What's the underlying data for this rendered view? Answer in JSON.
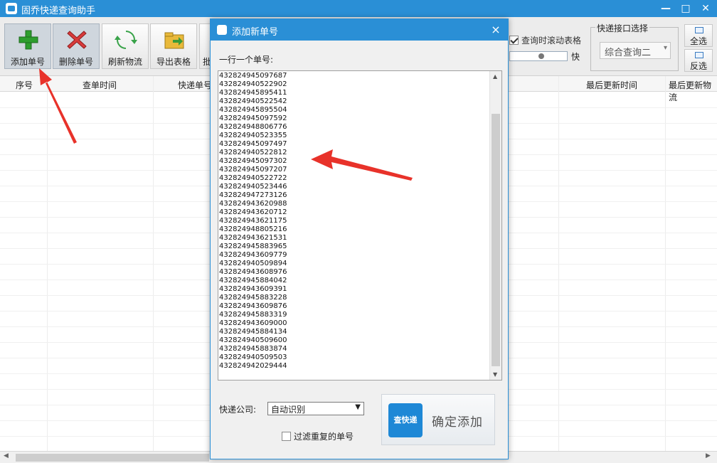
{
  "window": {
    "title": "固乔快递查询助手",
    "minimize": "—",
    "maximize": "□",
    "close": "✕"
  },
  "toolbar": {
    "add": "添加单号",
    "delete": "删除单号",
    "refresh": "刷新物流",
    "export": "导出表格",
    "partial_next": "批"
  },
  "options": {
    "scroll_checkbox": "查询时滚动表格",
    "scroll_checked": true,
    "speed_label": "快",
    "speed_level": 0.55,
    "api_group": "快递接口选择",
    "api_selected": "综合查询二",
    "select_all": "全选",
    "invert": "反选"
  },
  "grid": {
    "columns": [
      "序号",
      "查单时间",
      "快递单号",
      "最后更新时间",
      "最后更新物流"
    ]
  },
  "dialog": {
    "title": "添加新单号",
    "close": "×",
    "label": "一行一个单号:",
    "numbers": [
      "432824945097687",
      "432824940522902",
      "432824945895411",
      "432824940522542",
      "432824945895504",
      "432824945097592",
      "432824948806776",
      "432824940523355",
      "432824945097497",
      "432824940522812",
      "432824945097302",
      "432824945097207",
      "432824940522722",
      "432824940523446",
      "432824947273126",
      "432824943620988",
      "432824943620712",
      "432824943621175",
      "432824948805216",
      "432824943621531",
      "432824945883965",
      "432824943609779",
      "432824940509894",
      "432824943608976",
      "432824945884042",
      "432824943609391",
      "432824945883228",
      "432824943609876",
      "432824945883319",
      "432824943609000",
      "432824945884134",
      "432824940509600",
      "432824945883874",
      "432824940509503",
      "432824942029444"
    ],
    "company_label": "快递公司:",
    "company_value": "自动识别",
    "filter_label": "过滤重复的单号",
    "filter_checked": false,
    "confirm_logo": "查快递",
    "confirm_label": "确定添加"
  },
  "icons": {
    "app": "app-logo-icon",
    "add": "plus-icon",
    "delete": "red-x-icon",
    "refresh": "refresh-icon",
    "export": "folder-export-icon"
  }
}
